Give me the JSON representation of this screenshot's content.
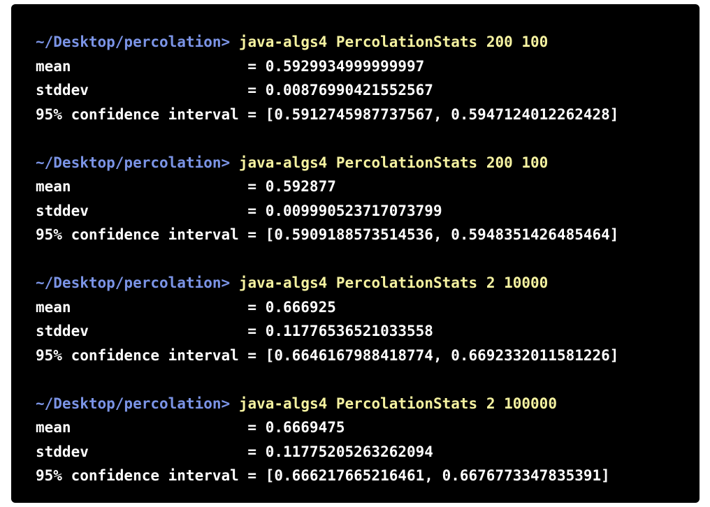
{
  "colors": {
    "background": "#000000",
    "prompt": "#7b94e6",
    "command": "#f5f2a0",
    "output": "#ffffff"
  },
  "runs": [
    {
      "prompt": "~/Desktop/percolation>",
      "command": "java-algs4 PercolationStats 200 100",
      "mean_line": "mean                    = 0.5929934999999997",
      "stddev_line": "stddev                  = 0.00876990421552567",
      "ci_line": "95% confidence interval = [0.5912745987737567, 0.5947124012262428]"
    },
    {
      "prompt": "~/Desktop/percolation>",
      "command": "java-algs4 PercolationStats 200 100",
      "mean_line": "mean                    = 0.592877",
      "stddev_line": "stddev                  = 0.009990523717073799",
      "ci_line": "95% confidence interval = [0.5909188573514536, 0.5948351426485464]"
    },
    {
      "prompt": "~/Desktop/percolation>",
      "command": "java-algs4 PercolationStats 2 10000",
      "mean_line": "mean                    = 0.666925",
      "stddev_line": "stddev                  = 0.11776536521033558",
      "ci_line": "95% confidence interval = [0.6646167988418774, 0.6692332011581226]"
    },
    {
      "prompt": "~/Desktop/percolation>",
      "command": "java-algs4 PercolationStats 2 100000",
      "mean_line": "mean                    = 0.6669475",
      "stddev_line": "stddev                  = 0.11775205263262094",
      "ci_line": "95% confidence interval = [0.666217665216461, 0.6676773347835391]"
    }
  ]
}
